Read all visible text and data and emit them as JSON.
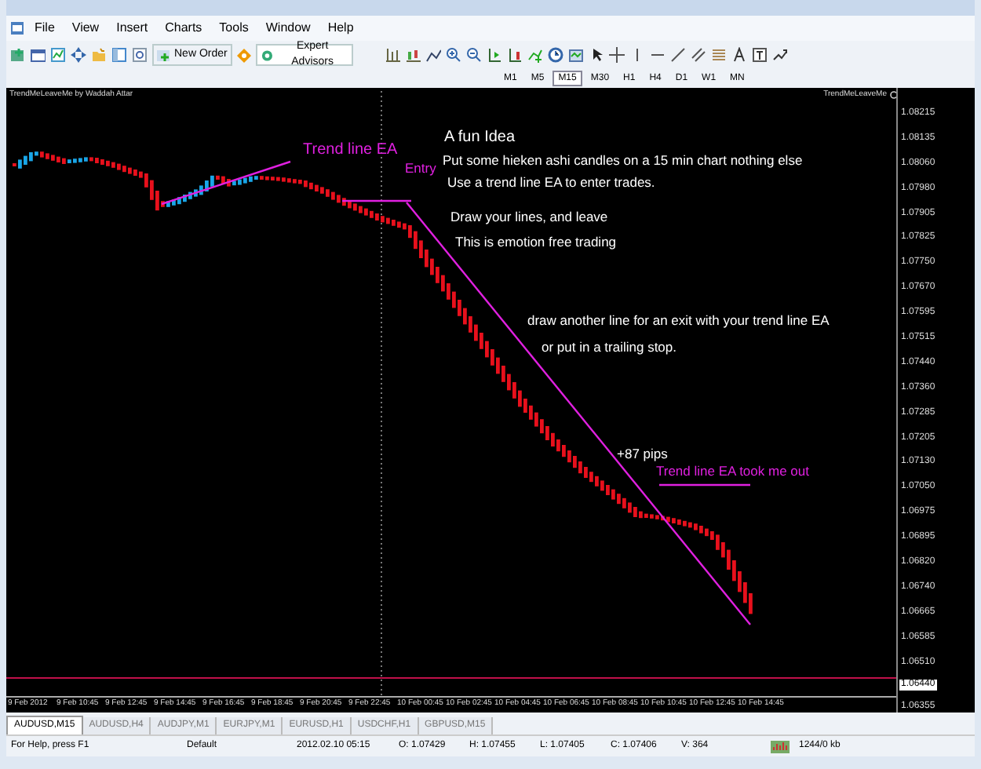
{
  "menu": [
    "File",
    "View",
    "Insert",
    "Charts",
    "Tools",
    "Window",
    "Help"
  ],
  "toolbar": {
    "buttons": [
      "New Order",
      "Expert Advisors"
    ]
  },
  "timeframes": [
    {
      "label": "M1",
      "selected": false
    },
    {
      "label": "M5",
      "selected": false
    },
    {
      "label": "M15",
      "selected": true
    },
    {
      "label": "M30",
      "selected": false
    },
    {
      "label": "H1",
      "selected": false
    },
    {
      "label": "H4",
      "selected": false
    },
    {
      "label": "D1",
      "selected": false
    },
    {
      "label": "W1",
      "selected": false
    },
    {
      "label": "MN",
      "selected": false
    }
  ],
  "chart": {
    "indicator_left": "TrendMeLeaveMe by Waddah Attar",
    "indicator_right": "TrendMeLeaveMe",
    "annotations": [
      {
        "text": "A fun Idea",
        "color": "#ffffff"
      },
      {
        "text": "Put some hieken ashi candles on a 15 min chart nothing else",
        "color": "#ffffff"
      },
      {
        "text": "Use a trend line EA to enter trades.",
        "color": "#ffffff"
      },
      {
        "text": "Trend line EA",
        "color": "#e020e0"
      },
      {
        "text": "Entry",
        "color": "#e020e0"
      },
      {
        "text": "Draw your lines, and leave",
        "color": "#ffffff"
      },
      {
        "text": "This is emotion free trading",
        "color": "#ffffff"
      },
      {
        "text": "draw another line for an exit with your trend line EA",
        "color": "#ffffff"
      },
      {
        "text": "or put in a trailing stop.",
        "color": "#ffffff"
      },
      {
        "text": "+87 pips",
        "color": "#ffffff"
      },
      {
        "text": "Trend line EA took me out",
        "color": "#e020e0"
      }
    ],
    "price_scale": [
      "1.08215",
      "1.08135",
      "1.08060",
      "1.07980",
      "1.07905",
      "1.07825",
      "1.07750",
      "1.07670",
      "1.07595",
      "1.07515",
      "1.07440",
      "1.07360",
      "1.07285",
      "1.07205",
      "1.07130",
      "1.07050",
      "1.06975",
      "1.06895",
      "1.06820",
      "1.06740",
      "1.06665",
      "1.06585",
      "1.06510"
    ],
    "bid_price": "1.06440",
    "last_scale": "1.06355",
    "time_axis": [
      "9 Feb 2012",
      "9 Feb 10:45",
      "9 Feb 12:45",
      "9 Feb 14:45",
      "9 Feb 16:45",
      "9 Feb 18:45",
      "9 Feb 20:45",
      "9 Feb 22:45",
      "10 Feb 00:45",
      "10 Feb 02:45",
      "10 Feb 04:45",
      "10 Feb 06:45",
      "10 Feb 08:45",
      "10 Feb 10:45",
      "10 Feb 12:45",
      "10 Feb 14:45"
    ]
  },
  "tabs": [
    {
      "label": "AUDUSD,M15",
      "selected": true
    },
    {
      "label": "AUDUSD,H4",
      "selected": false
    },
    {
      "label": "AUDJPY,M1",
      "selected": false
    },
    {
      "label": "EURJPY,M1",
      "selected": false
    },
    {
      "label": "EURUSD,H1",
      "selected": false
    },
    {
      "label": "USDCHF,H1",
      "selected": false
    },
    {
      "label": "GBPUSD,M15",
      "selected": false
    }
  ],
  "status_bar": [
    "For Help, press F1",
    "Default",
    "2012.02.10 05:15",
    "O: 1.07429",
    "H: 1.07455",
    "L: 1.07405",
    "C: 1.07406",
    "V: 364",
    "1244/0 kb"
  ]
}
